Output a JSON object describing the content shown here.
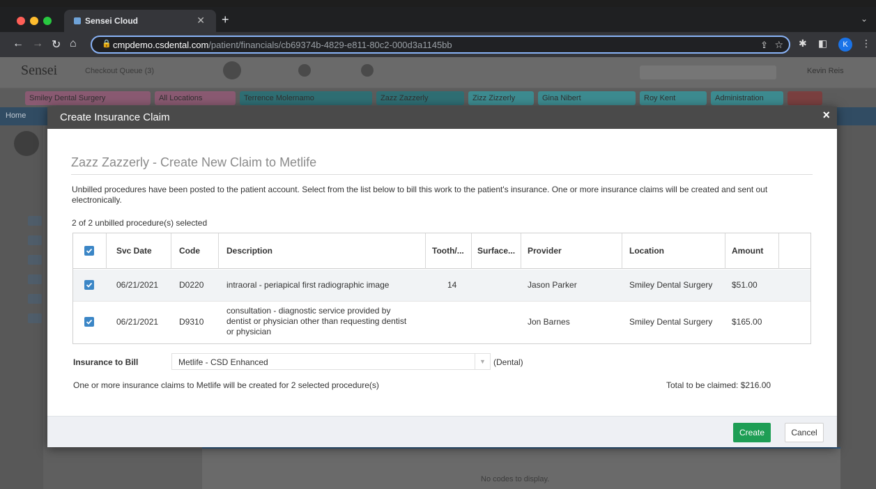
{
  "browser": {
    "tab_title": "Sensei Cloud",
    "url_domain": "cmpdemo.csdental.com",
    "url_path": "/patient/financials/cb69374b-4829-e811-80c2-000d3a1145bb",
    "profile_initial": "K"
  },
  "app": {
    "logo": "Sensei",
    "checkout_queue": "Checkout Queue (3)",
    "user": "Kevin Reis",
    "patient_tabs": [
      "Smiley Dental Surgery",
      "All Locations",
      "Terrence Molernamo",
      "Zazz Zazzerly",
      "Zizz Zizzerly",
      "Gina Nibert",
      "Roy Kent",
      "Administration"
    ],
    "home_label": "Home",
    "no_codes": "No codes to display."
  },
  "modal": {
    "title": "Create Insurance Claim",
    "close": "×",
    "heading": "Zazz Zazzerly - Create New Claim to Metlife",
    "intro": "Unbilled procedures have been posted to the patient account. Select from the list below to bill this work to the patient's insurance. One or more insurance claims will be created and sent out electronically.",
    "selected_count": "2 of 2 unbilled procedure(s) selected",
    "columns": [
      "Svc Date",
      "Code",
      "Description",
      "Tooth/...",
      "Surface...",
      "Provider",
      "Location",
      "Amount"
    ],
    "rows": [
      {
        "selected": true,
        "svc_date": "06/21/2021",
        "code": "D0220",
        "description": "intraoral - periapical first radiographic image",
        "tooth": "14",
        "surface": "",
        "provider": "Jason Parker",
        "location": "Smiley Dental Surgery",
        "amount": "$51.00"
      },
      {
        "selected": true,
        "svc_date": "06/21/2021",
        "code": "D9310",
        "description": "consultation - diagnostic service provided by dentist or physician other than requesting dentist or physician",
        "tooth": "",
        "surface": "",
        "provider": "Jon Barnes",
        "location": "Smiley Dental Surgery",
        "amount": "$165.00"
      }
    ],
    "insurance_label": "Insurance to Bill",
    "insurance_value": "Metlife - CSD Enhanced",
    "insurance_type": "(Dental)",
    "summary": "One or more insurance claims to Metlife will be created for 2 selected procedure(s)",
    "total": "Total to be claimed: $216.00",
    "create_label": "Create",
    "cancel_label": "Cancel"
  },
  "colors": {
    "modal_header": "#4a4a4a",
    "create_button": "#1e9e55",
    "checkbox": "#3b86c6"
  }
}
